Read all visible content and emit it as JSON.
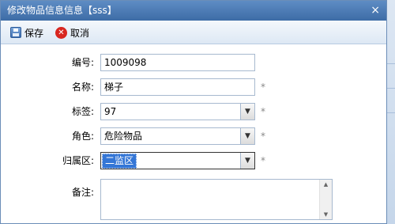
{
  "window": {
    "title": "修改物品信息信息【sss】",
    "close_glyph": "×"
  },
  "toolbar": {
    "save_label": "保存",
    "cancel_label": "取消",
    "cancel_glyph": "✕"
  },
  "form": {
    "code": {
      "label": "编号:",
      "value": "1009098"
    },
    "name": {
      "label": "名称:",
      "value": "梯子",
      "required": "*"
    },
    "tag": {
      "label": "标签:",
      "value": "97",
      "required": "*"
    },
    "role": {
      "label": "角色:",
      "value": "危险物品",
      "required": "*"
    },
    "region": {
      "label": "归属区:",
      "value": "二监区",
      "required": "*"
    },
    "remark": {
      "label": "备注:",
      "value": ""
    },
    "dropdown_glyph": "▼",
    "scroll_up_glyph": "▲",
    "scroll_down_glyph": "▼"
  },
  "colors": {
    "titlebar": "#4a7ab6",
    "selection": "#3476d6",
    "cancel_icon": "#d8261f"
  },
  "icons": {
    "save": "save-disk-icon",
    "cancel": "cancel-x-circle-icon",
    "close": "close-icon",
    "dropdown": "dropdown-arrow-icon"
  }
}
